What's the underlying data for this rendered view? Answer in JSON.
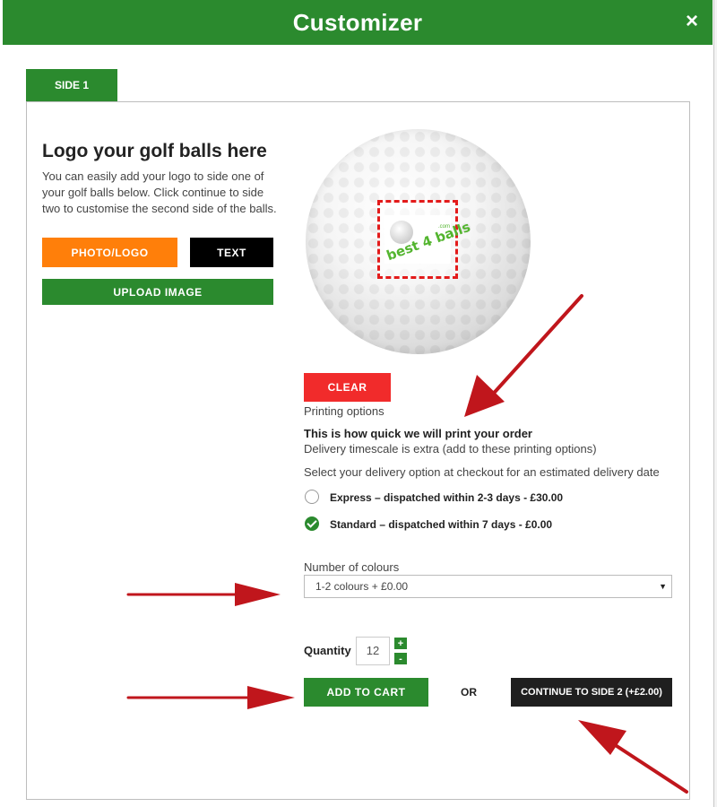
{
  "header": {
    "title": "Customizer",
    "close_icon": "×"
  },
  "tab": {
    "label": "SIDE 1"
  },
  "intro": {
    "heading": "Logo your golf balls here",
    "description": "You can easily add your logo to side one of your golf balls below. Click continue to side two to customise the second side of the balls."
  },
  "buttons": {
    "photo_logo": "PHOTO/LOGO",
    "text": "TEXT",
    "upload_image": "UPLOAD IMAGE",
    "clear": "CLEAR",
    "add_to_cart": "ADD TO CART",
    "continue_side2": "CONTINUE TO SIDE 2 (+£2.00)"
  },
  "preview": {
    "logo_text": "best 4 balls",
    "logo_subtext": ".com"
  },
  "printing": {
    "label": "Printing options",
    "heading": "This is how quick we will print your order",
    "note": "Delivery timescale is extra (add to these printing options)",
    "select_note": "Select your delivery option at checkout for an estimated delivery date",
    "options": [
      {
        "label": "Express – dispatched within 2-3 days - £30.00",
        "selected": false
      },
      {
        "label": "Standard – dispatched within 7 days - £0.00",
        "selected": true
      }
    ]
  },
  "colours": {
    "label": "Number of colours",
    "selected": "1-2 colours + £0.00"
  },
  "quantity": {
    "label": "Quantity",
    "value": "12",
    "plus": "+",
    "minus": "-"
  },
  "or_label": "OR",
  "colors": {
    "green": "#2b8a2e",
    "orange": "#ff7f0a",
    "red": "#f12b2b",
    "black": "#1f1f1f",
    "arrow": "#c0161c"
  }
}
